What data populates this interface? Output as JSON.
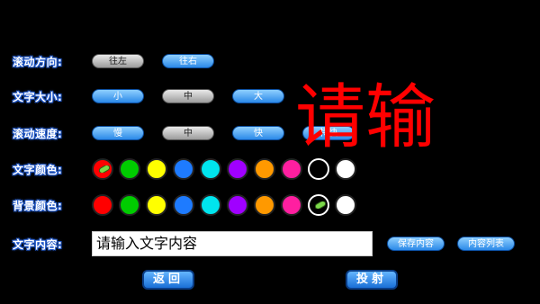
{
  "rows": {
    "scroll_direction": {
      "label": "滚动方向:",
      "options": [
        "往左",
        "往右"
      ]
    },
    "text_size": {
      "label": "文字大小:",
      "options": [
        "小",
        "中",
        "大"
      ]
    },
    "scroll_speed": {
      "label": "滚动速度:",
      "options": [
        "慢",
        "中",
        "快",
        "特快"
      ]
    },
    "text_color": {
      "label": "文字颜色:"
    },
    "bg_color": {
      "label": "背景颜色:"
    },
    "text_content": {
      "label": "文字内容:",
      "value": "请输入文字内容",
      "save": "保存内容",
      "list": "内容列表"
    }
  },
  "palette": [
    "#ff0000",
    "#00cc00",
    "#ffff00",
    "#1e7bff",
    "#00e5ee",
    "#a000ff",
    "#ff9900",
    "#ff1fa0",
    "#000000",
    "#ffffff"
  ],
  "selected": {
    "text_color": 0,
    "bg_color": 8
  },
  "actions": {
    "back": "返回",
    "launch": "投射"
  },
  "preview_text": "请输"
}
